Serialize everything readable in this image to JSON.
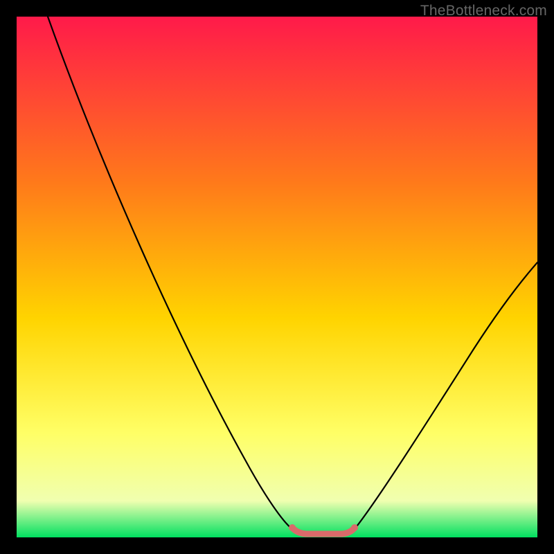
{
  "watermark": "TheBottleneck.com",
  "colors": {
    "black": "#000000",
    "curve": "#000000",
    "highlight": "#d96a6a",
    "grad_top": "#ff1a4a",
    "grad_mid1": "#ff7a1a",
    "grad_mid2": "#ffd400",
    "grad_mid3": "#ffff66",
    "grad_mid4": "#f0ffb0",
    "grad_bottom": "#00e060"
  },
  "chart_data": {
    "type": "line",
    "title": "",
    "xlabel": "",
    "ylabel": "",
    "xlim": [
      0,
      1
    ],
    "ylim": [
      0,
      1
    ],
    "series": [
      {
        "name": "bottleneck-curve",
        "x": [
          0.0,
          0.05,
          0.1,
          0.15,
          0.2,
          0.25,
          0.3,
          0.35,
          0.4,
          0.45,
          0.5,
          0.55,
          0.58,
          0.62,
          0.66,
          0.7,
          0.75,
          0.8,
          0.85,
          0.9,
          0.95,
          1.0
        ],
        "y": [
          1.0,
          0.92,
          0.84,
          0.76,
          0.68,
          0.59,
          0.5,
          0.41,
          0.31,
          0.21,
          0.11,
          0.03,
          0.01,
          0.01,
          0.03,
          0.09,
          0.18,
          0.27,
          0.35,
          0.42,
          0.48,
          0.53
        ]
      }
    ],
    "flat_region_x": [
      0.52,
      0.65
    ],
    "flat_region_y": 0.015
  }
}
